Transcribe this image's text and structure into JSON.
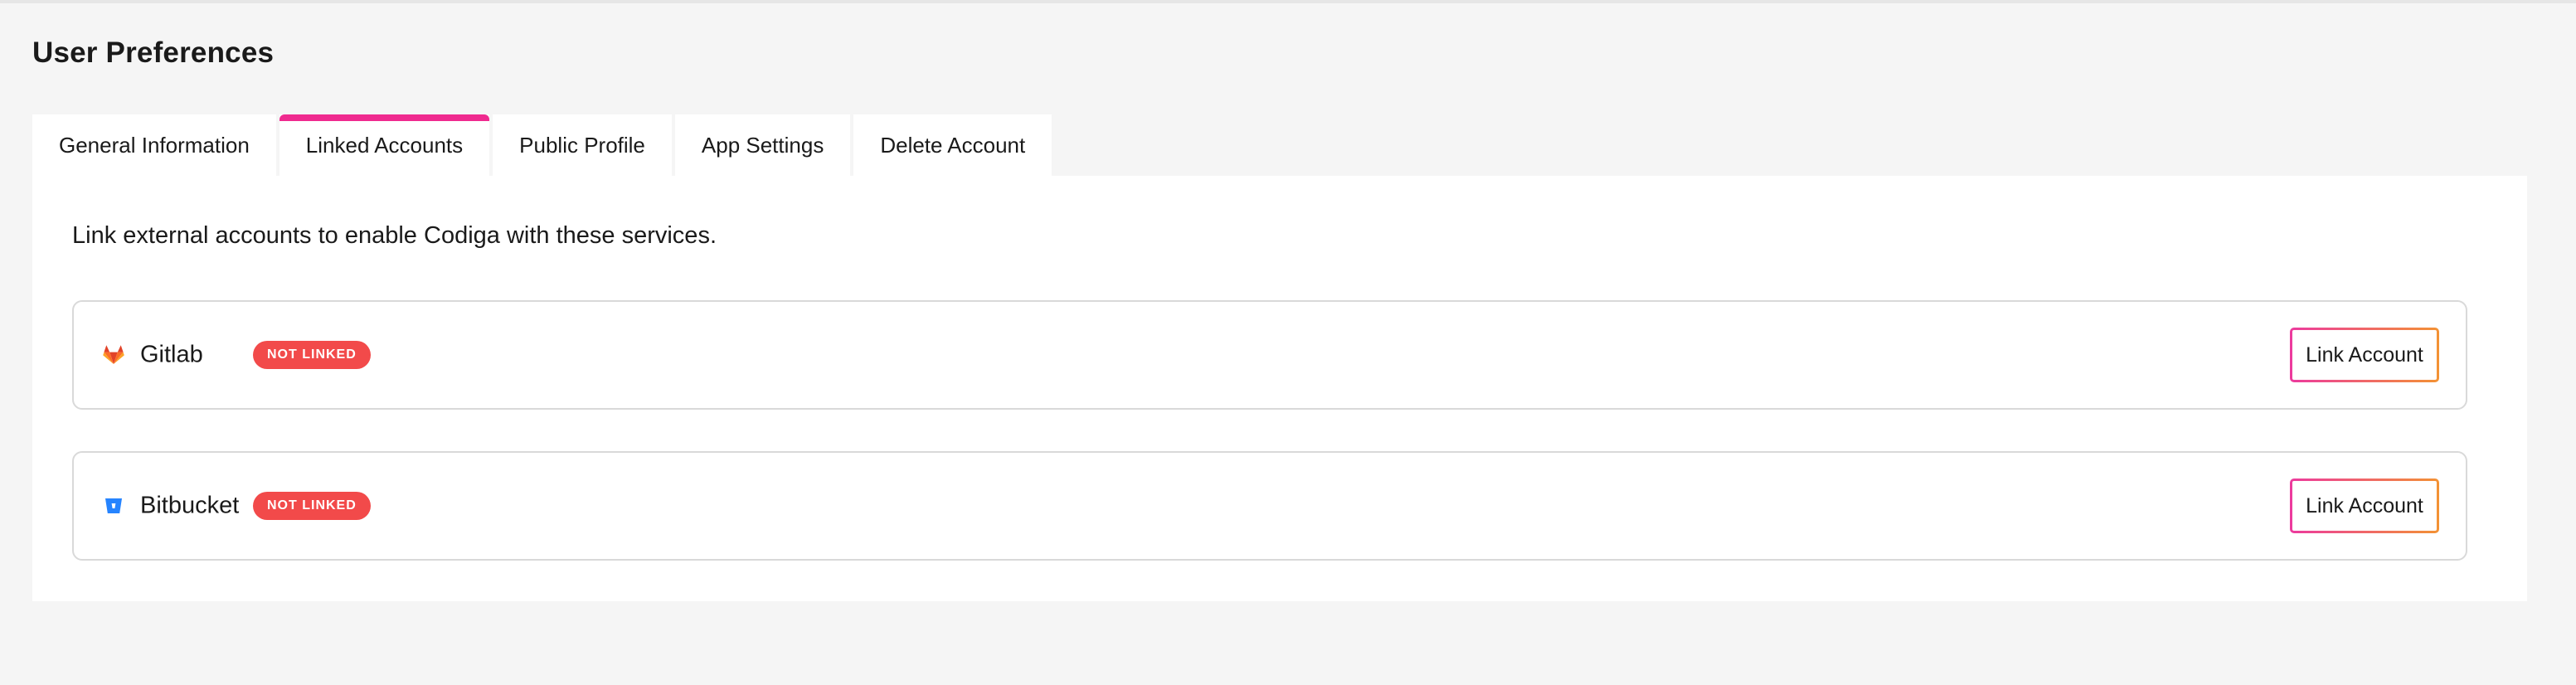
{
  "page": {
    "title": "User Preferences"
  },
  "tabs": [
    {
      "label": "General Information",
      "active": false
    },
    {
      "label": "Linked Accounts",
      "active": true
    },
    {
      "label": "Public Profile",
      "active": false
    },
    {
      "label": "App Settings",
      "active": false
    },
    {
      "label": "Delete Account",
      "active": false
    }
  ],
  "linked_accounts": {
    "intro": "Link external accounts to enable Codiga with these services.",
    "accounts": [
      {
        "name": "Gitlab",
        "icon": "gitlab-icon",
        "status": "NOT LINKED",
        "button_label": "Link Account"
      },
      {
        "name": "Bitbucket",
        "icon": "bitbucket-icon",
        "status": "NOT LINKED",
        "button_label": "Link Account"
      }
    ]
  },
  "colors": {
    "active_tab_accent": "#ef2a8f",
    "badge_red": "#f24a4a",
    "button_gradient_start": "#ec3a9e",
    "button_gradient_end": "#f39234",
    "gitlab_orange": "#e24329",
    "bitbucket_blue": "#2684ff"
  }
}
